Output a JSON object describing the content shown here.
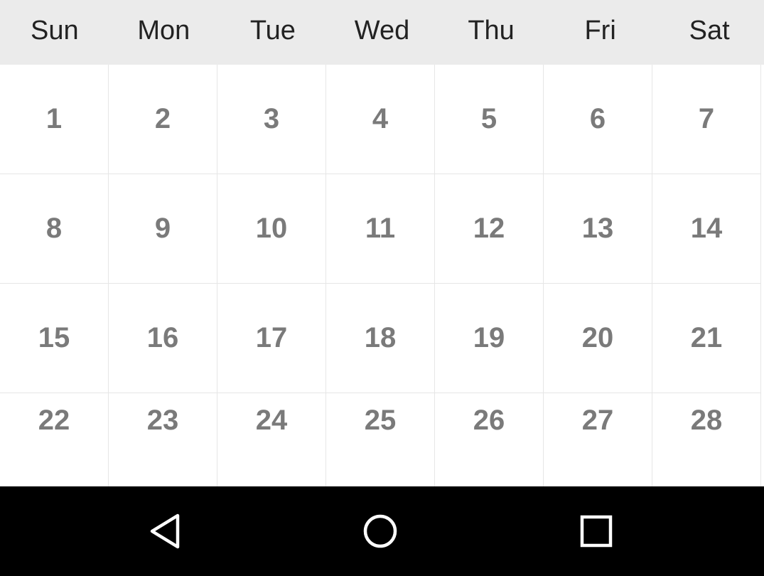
{
  "weekdays": [
    "Sun",
    "Mon",
    "Tue",
    "Wed",
    "Thu",
    "Fri",
    "Sat"
  ],
  "days": [
    "1",
    "2",
    "3",
    "4",
    "5",
    "6",
    "7",
    "8",
    "9",
    "10",
    "11",
    "12",
    "13",
    "14",
    "15",
    "16",
    "17",
    "18",
    "19",
    "20",
    "21",
    "22",
    "23",
    "24",
    "25",
    "26",
    "27",
    "28"
  ],
  "nav_bar": {
    "buttons": [
      "back-icon",
      "home-icon",
      "recents-icon"
    ]
  },
  "colors": {
    "header_bg": "#ebebeb",
    "weekday_text": "#222222",
    "day_text": "#7a7a7a",
    "grid_line": "#e6e6e6",
    "nav_bg": "#000000",
    "nav_icon": "#ffffff"
  }
}
